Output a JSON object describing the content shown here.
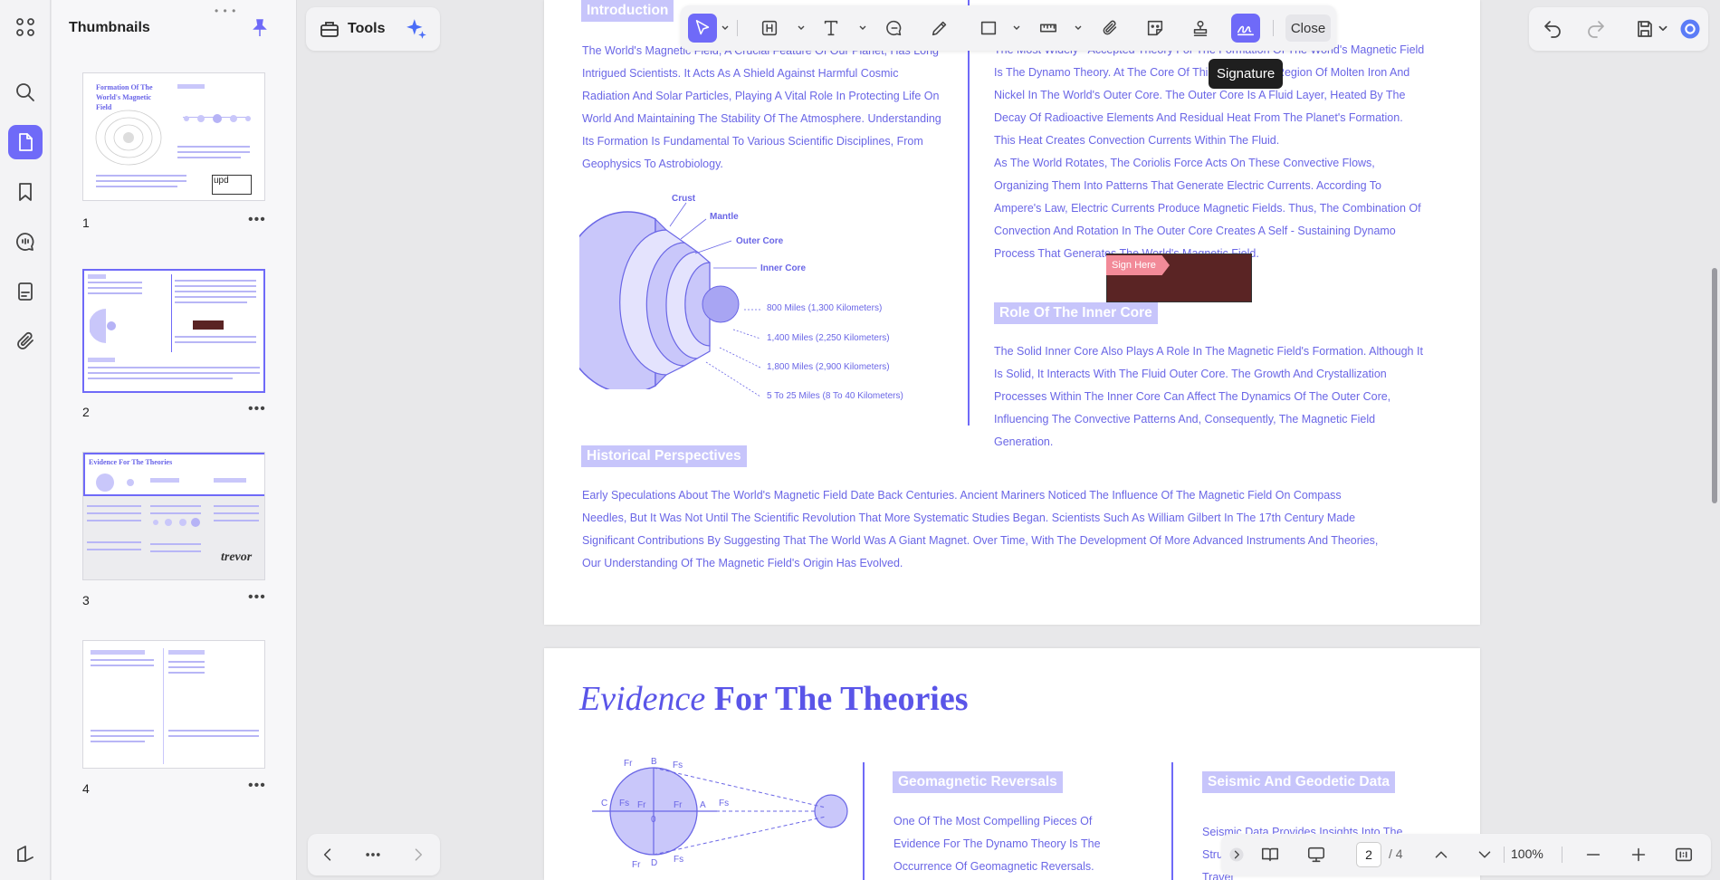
{
  "sidebar": {
    "title": "Thumbnails",
    "grip": "• • •",
    "pages": [
      {
        "num": "1",
        "thumb_title": "Formation Of The World's Magnetic Field",
        "thumb_badge": "upd"
      },
      {
        "num": "2"
      },
      {
        "num": "3",
        "thumb_title": "Evidence For The Theories",
        "thumb_sign": "trevor"
      },
      {
        "num": "4"
      }
    ],
    "more": "•••"
  },
  "tools": {
    "label": "Tools"
  },
  "toolbar": {
    "close_label": "Close",
    "tooltip": "Signature"
  },
  "page2": {
    "intro_heading": "Introduction",
    "intro_text": "The World's Magnetic Field, A Crucial Feature Of Our Planet, Has Long Intrigued Scientists. It Acts As A Shield Against Harmful Cosmic Radiation And Solar Particles, Playing A Vital Role In Protecting Life On World And Maintaining The Stability Of The Atmosphere. Understanding Its Formation Is Fundamental To Various Scientific Disciplines, From Geophysics To Astrobiology.",
    "diagram": {
      "crust": "Crust",
      "mantle": "Mantle",
      "outer_core": "Outer Core",
      "inner_core": "Inner Core",
      "d1": "800 Miles (1,300 Kilometers)",
      "d2": "1,400 Miles (2,250 Kilometers)",
      "d3": "1,800 Miles (2,900 Kilometers)",
      "d4": "5 To 25 Miles (8 To 40 Kilometers)"
    },
    "right_text_1": "The Most Widely - Accepted Theory For The Formation Of The World's Magnetic Field Is The Dynamo Theory. At The Core Of This Theory Is A Region Of Molten Iron And Nickel In The World's Outer Core. The Outer Core Is A Fluid Layer, Heated By The Decay Of Radioactive Elements And Residual Heat From The Planet's Formation. This Heat Creates Convection Currents Within The Fluid.",
    "right_text_2": "As The World Rotates, The Coriolis Force Acts On These Convective Flows, Organizing Them Into Patterns That Generate Electric Currents. According To Ampere's Law, Electric Currents Produce Magnetic Fields. Thus, The Combination Of Convection And Rotation In The Outer Core Creates A Self - Sustaining Dynamo Process That Generates The World's Magnetic Field.",
    "sign_here": "Sign Here",
    "inner_core_heading": "Role Of The Inner Core",
    "inner_core_text": "The Solid Inner Core Also Plays A Role In The Magnetic Field's Formation. Although It Is Solid, It Interacts With The Fluid Outer Core. The Growth And Crystallization Processes Within The Inner Core Can Affect The Dynamics Of The Outer Core, Influencing The Convective Patterns And, Consequently, The Magnetic Field Generation.",
    "hist_heading": "Historical Perspectives",
    "hist_text": "Early Speculations About The World's Magnetic Field Date Back Centuries. Ancient Mariners Noticed The Influence Of The Magnetic Field On Compass Needles, But It Was Not Until The Scientific Revolution That More Systematic Studies Began. Scientists Such As William Gilbert In The 17th Century Made Significant Contributions By Suggesting That The World Was A Giant Magnet. Over Time, With The Development Of More Advanced Instruments And Theories, Our Understanding Of The Magnetic Field's Origin Has Evolved."
  },
  "page3": {
    "title_italic": "Evidence",
    "title_bold": "For The Theories",
    "geo_heading": "Geomagnetic Reversals",
    "geo_text": "One Of The Most Compelling Pieces Of Evidence For The Dynamo Theory Is The Occurrence Of Geomagnetic Reversals. Geological Studies Of",
    "seis_heading": "Seismic And Geodetic Data",
    "seis_text": "Seismic Data Provides Insights Into The Structure... By Analyzing How Seismic Waves Travel",
    "diag_labels": {
      "fr1": "Fr",
      "b": "B",
      "fs1": "Fs",
      "c": "C",
      "fs2": "Fs",
      "fr2": "Fr",
      "zero": "0",
      "fr3": "Fr",
      "a": "A",
      "fs3": "Fs",
      "fr4": "Fr",
      "d": "D",
      "fs4": "Fs"
    }
  },
  "viewbar": {
    "current_page": "2",
    "total_pages": "/ 4",
    "zoom": "100%"
  },
  "colors": {
    "accent": "#6f6af8",
    "doc_text": "#6a66e6",
    "heading_bg": "#c7c5fb",
    "sign_box": "#5a2424",
    "sign_tag": "#f28a98"
  }
}
